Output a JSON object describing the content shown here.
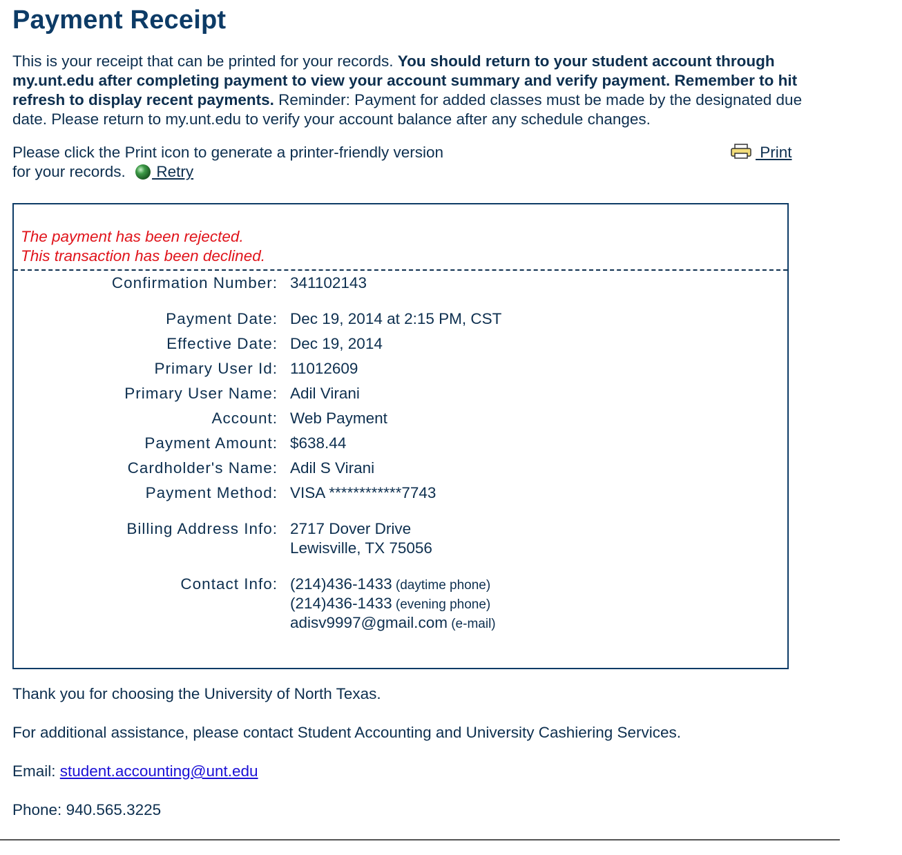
{
  "header": {
    "title": "Payment Receipt"
  },
  "intro": {
    "text1": "This is your receipt that can be printed for your records. ",
    "bold": "You should return to your student account through my.unt.edu after completing payment to view your account summary and verify payment. Remember to hit refresh to display recent payments.",
    "text2": " Reminder: Payment for added classes must be made by the designated due date. Please return to my.unt.edu to verify your account balance after any schedule changes."
  },
  "print_instructions": "Please click the Print icon to generate a printer-friendly version for your records.",
  "retry_label": " Retry",
  "print_label": " Print",
  "status": {
    "line1": "The payment has been rejected.",
    "line2": "This transaction has been declined."
  },
  "details": {
    "confirmation_label": "Confirmation Number:",
    "confirmation": "341102143",
    "payment_date_label": "Payment Date:",
    "payment_date": "Dec 19, 2014 at 2:15 PM, CST",
    "effective_date_label": "Effective Date:",
    "effective_date": "Dec 19, 2014",
    "user_id_label": "Primary User Id:",
    "user_id": "11012609",
    "user_name_label": "Primary User Name:",
    "user_name": "Adil Virani",
    "account_label": "Account:",
    "account": "Web Payment",
    "amount_label": "Payment Amount:",
    "amount": "$638.44",
    "cardholder_label": "Cardholder's Name:",
    "cardholder": "Adil S Virani",
    "method_label": "Payment Method:",
    "method": "VISA ************7743",
    "billing_label": "Billing Address Info:",
    "billing_line1": "2717 Dover Drive",
    "billing_line2": "Lewisville, TX 75056",
    "contact_label": "Contact Info:",
    "day_phone": "(214)436-1433",
    "day_phone_note": " (daytime phone)",
    "eve_phone": "(214)436-1433",
    "eve_phone_note": " (evening phone)",
    "email": "adisv9997@gmail.com",
    "email_note": " (e-mail)"
  },
  "footer": {
    "thanks": "Thank you for choosing the University of North Texas.",
    "assistance": "For additional assistance, please contact Student Accounting and University Cashiering Services.",
    "email_label": "Email: ",
    "email": "student.accounting@unt.edu",
    "phone": "Phone: 940.565.3225"
  }
}
